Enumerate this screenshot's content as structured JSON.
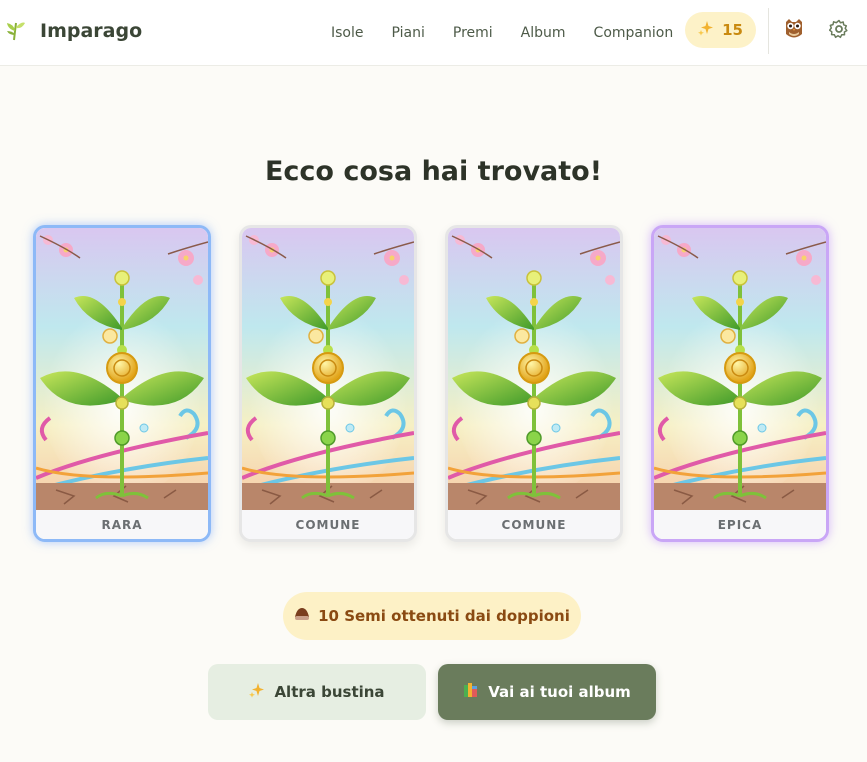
{
  "app": {
    "name": "Imparago"
  },
  "nav": {
    "items": [
      {
        "label": "Isole"
      },
      {
        "label": "Piani"
      },
      {
        "label": "Premi"
      },
      {
        "label": "Album"
      },
      {
        "label": "Companion"
      }
    ]
  },
  "points": {
    "icon": "sparkles-icon",
    "value": "15"
  },
  "main": {
    "title": "Ecco cosa hai trovato!"
  },
  "cards": [
    {
      "rarity": "RARA",
      "accent": "#8db9f7"
    },
    {
      "rarity": "COMUNE",
      "accent": "#e6e6e6"
    },
    {
      "rarity": "COMUNE",
      "accent": "#e6e6e6"
    },
    {
      "rarity": "EPICA",
      "accent": "#c9a6f6"
    }
  ],
  "seeds": {
    "icon": "seed-icon",
    "text": "10 Semi ottenuti dai doppioni"
  },
  "actions": {
    "another_pack": {
      "icon": "sparkles-icon",
      "label": "Altra bustina"
    },
    "go_albums": {
      "icon": "books-icon",
      "label": "Vai ai tuoi album"
    }
  },
  "colors": {
    "primary": "#6a7c5c",
    "accent_gold": "#c98a10",
    "background": "#fcfbf7"
  }
}
